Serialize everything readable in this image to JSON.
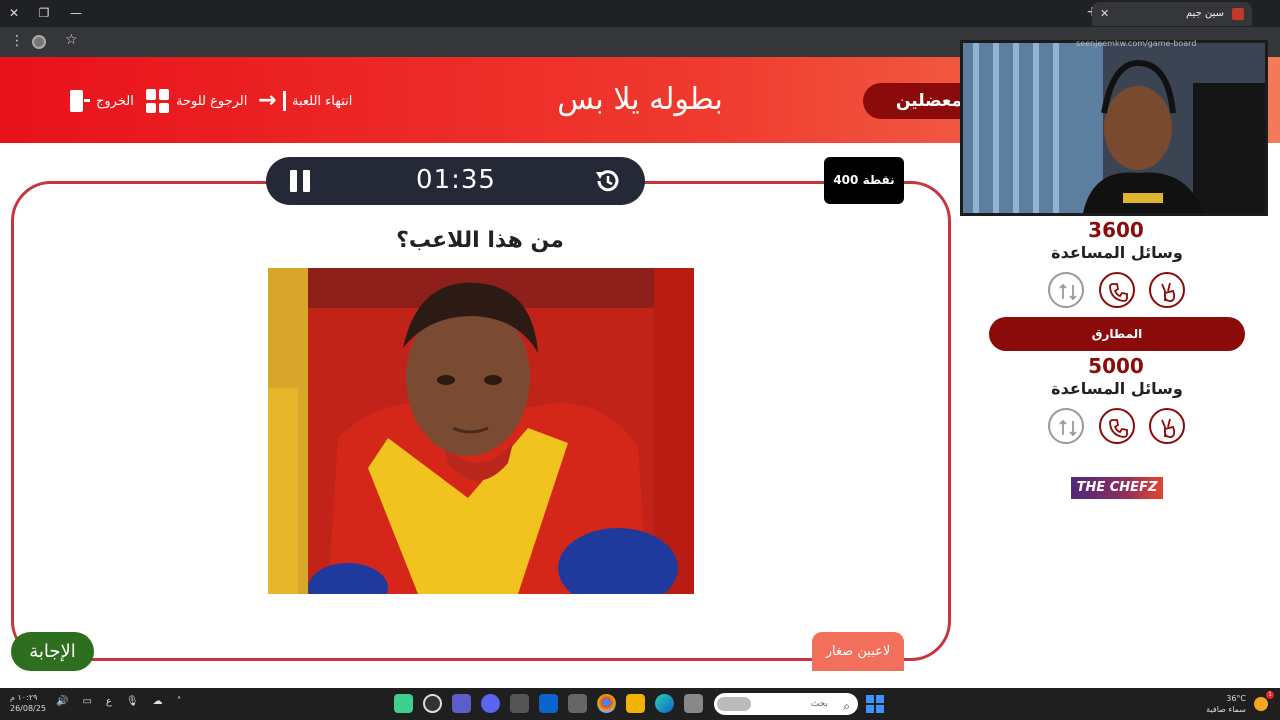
{
  "browser": {
    "tab_title": "سين جيم",
    "url_fragment": "seenjeemkw.com/game-board"
  },
  "header": {
    "title": "بطوله يلا بس",
    "nav_exit": "الخروج",
    "nav_board": "الرجوع للوحة",
    "nav_end": "انتهاء اللعبة",
    "team1_name": "معضلين"
  },
  "question": {
    "timer": "01:35",
    "points": "400 نقطة",
    "text": "من هذا اللاعب؟",
    "answer_button": "الإجابة",
    "category": "لاعبين صغار"
  },
  "scoreboard": {
    "team1_score": "3600",
    "team1_aids_label": "وسائل المساعدة",
    "team2_name": "المطارق",
    "team2_score": "5000",
    "team2_aids_label": "وسائل المساعدة",
    "sponsor": "THE CHEFZ"
  },
  "taskbar": {
    "time": "١٠:٢٩ م",
    "date": "26/08/25",
    "lang": "ع",
    "search_placeholder": "بحث",
    "temperature": "36°C",
    "weather_desc": "سماء صافية",
    "notif_count": "1"
  },
  "colors": {
    "banner_start": "#e8111b",
    "banner_end": "#f47b58",
    "team_maroon": "#8b0a0a",
    "card_border": "#c6363f",
    "answer_green": "#2e6e1f",
    "category_salmon": "#f16f5b"
  }
}
